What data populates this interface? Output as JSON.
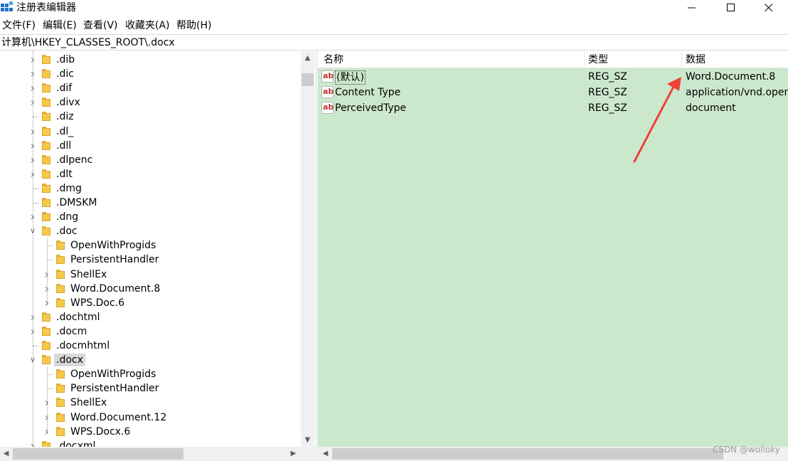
{
  "window": {
    "title": "注册表编辑器",
    "icon": "registry-editor-icon",
    "controls": [
      "minimize",
      "maximize",
      "close"
    ]
  },
  "menu": {
    "items": [
      "文件(F)",
      "编辑(E)",
      "查看(V)",
      "收藏夹(A)",
      "帮助(H)"
    ]
  },
  "address": {
    "path": "计算机\\HKEY_CLASSES_ROOT\\.docx"
  },
  "tree": {
    "items": [
      {
        "label": ".dib",
        "level": 0,
        "expander": "collapsed"
      },
      {
        "label": ".dic",
        "level": 0,
        "expander": "collapsed"
      },
      {
        "label": ".dif",
        "level": 0,
        "expander": "collapsed"
      },
      {
        "label": ".divx",
        "level": 0,
        "expander": "collapsed"
      },
      {
        "label": ".diz",
        "level": 0,
        "expander": "none"
      },
      {
        "label": ".dl_",
        "level": 0,
        "expander": "collapsed"
      },
      {
        "label": ".dll",
        "level": 0,
        "expander": "collapsed"
      },
      {
        "label": ".dlpenc",
        "level": 0,
        "expander": "collapsed"
      },
      {
        "label": ".dlt",
        "level": 0,
        "expander": "collapsed"
      },
      {
        "label": ".dmg",
        "level": 0,
        "expander": "none"
      },
      {
        "label": ".DMSKM",
        "level": 0,
        "expander": "none"
      },
      {
        "label": ".dng",
        "level": 0,
        "expander": "collapsed"
      },
      {
        "label": ".doc",
        "level": 0,
        "expander": "expanded"
      },
      {
        "label": "OpenWithProgids",
        "level": 1,
        "expander": "none"
      },
      {
        "label": "PersistentHandler",
        "level": 1,
        "expander": "none"
      },
      {
        "label": "ShellEx",
        "level": 1,
        "expander": "collapsed"
      },
      {
        "label": "Word.Document.8",
        "level": 1,
        "expander": "collapsed"
      },
      {
        "label": "WPS.Doc.6",
        "level": 1,
        "expander": "collapsed"
      },
      {
        "label": ".dochtml",
        "level": 0,
        "expander": "collapsed"
      },
      {
        "label": ".docm",
        "level": 0,
        "expander": "collapsed"
      },
      {
        "label": ".docmhtml",
        "level": 0,
        "expander": "none"
      },
      {
        "label": ".docx",
        "level": 0,
        "expander": "expanded",
        "selected": true
      },
      {
        "label": "OpenWithProgids",
        "level": 1,
        "expander": "none"
      },
      {
        "label": "PersistentHandler",
        "level": 1,
        "expander": "none"
      },
      {
        "label": "ShellEx",
        "level": 1,
        "expander": "collapsed"
      },
      {
        "label": "Word.Document.12",
        "level": 1,
        "expander": "collapsed"
      },
      {
        "label": "WPS.Docx.6",
        "level": 1,
        "expander": "collapsed"
      },
      {
        "label": ".docxml",
        "level": 0,
        "expander": "collapsed"
      }
    ]
  },
  "values": {
    "columns": [
      "名称",
      "类型",
      "数据"
    ],
    "rows": [
      {
        "name": "(默认)",
        "type": "REG_SZ",
        "data": "Word.Document.8",
        "icon": "string-value-icon",
        "focused": true
      },
      {
        "name": "Content Type",
        "type": "REG_SZ",
        "data": "application/vnd.openxmlformats-officedocument.wordprocessingml.document",
        "icon": "string-value-icon"
      },
      {
        "name": "PerceivedType",
        "type": "REG_SZ",
        "data": "document",
        "icon": "string-value-icon"
      }
    ],
    "icon_text": "ab",
    "background_color": "#cce8cc"
  },
  "annotation": {
    "arrow_color": "#f0413a",
    "points_to": "Word.Document.8"
  },
  "watermark": "CSDN @wolloky"
}
